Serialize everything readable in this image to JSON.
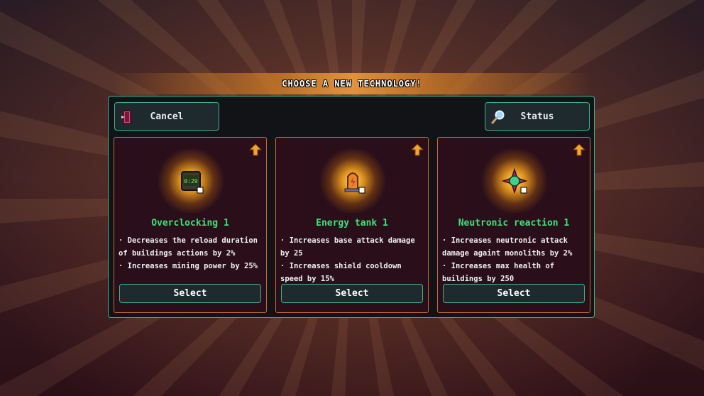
{
  "header": {
    "title": "CHOOSE A NEW TECHNOLOGY!"
  },
  "toolbar": {
    "cancel_label": "Cancel",
    "status_label": "Status"
  },
  "cards": [
    {
      "title": "Overclocking 1",
      "icon": "chip-icon",
      "icon_text": "0:29",
      "lines": [
        "· Decreases the reload duration of buildings actions by 2%",
        "· Increases mining power by 25%"
      ],
      "select_label": "Select"
    },
    {
      "title": "Energy tank 1",
      "icon": "energy-tank-icon",
      "lines": [
        "· Increases base attack damage by 25",
        "· Increases shield cooldown speed by 15%"
      ],
      "select_label": "Select"
    },
    {
      "title": "Neutronic reaction 1",
      "icon": "neutronic-orb-icon",
      "lines": [
        "· Increases neutronic attack damage againt monoliths by 2%",
        "· Increases max health of buildings by 250"
      ],
      "select_label": "Select"
    }
  ],
  "colors": {
    "accent": "#3fb58a",
    "card_border": "#c86a30",
    "title_green": "#3fe07a"
  }
}
